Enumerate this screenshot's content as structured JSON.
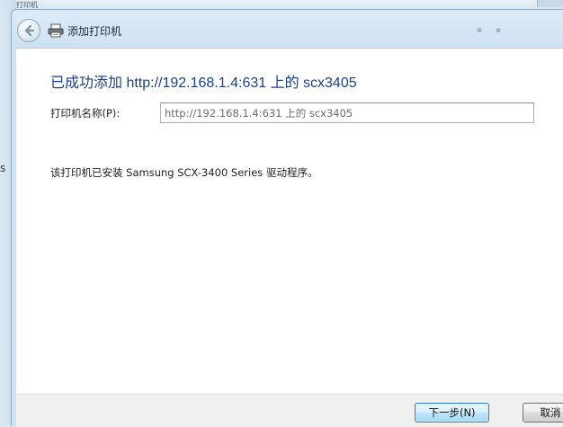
{
  "background": {
    "tiny_label": "添加打印机",
    "left_fragment_s": "s"
  },
  "window": {
    "title": "添加打印机",
    "back_icon": "back-arrow-icon",
    "printer_icon": "printer-icon"
  },
  "main": {
    "headline": "已成功添加 http://192.168.1.4:631 上的 scx3405",
    "printer_name_label": "打印机名称(P):",
    "printer_name_value": "http://192.168.1.4:631 上的 scx3405",
    "driver_message": "该打印机已安装 Samsung SCX-3400 Series 驱动程序。"
  },
  "footer": {
    "next_label": "下一步(N)",
    "cancel_label": "取消"
  },
  "colors": {
    "headline": "#1a3f8f",
    "frame": "#cfe2f1"
  }
}
